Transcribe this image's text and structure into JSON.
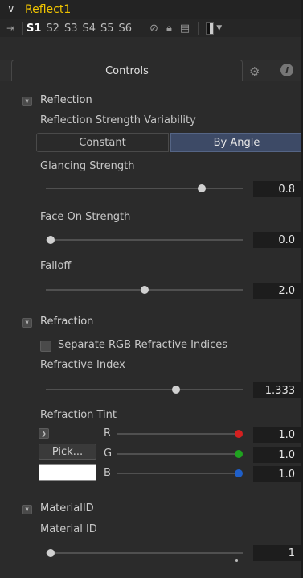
{
  "tool": {
    "title": "Reflect1",
    "slots": [
      "S1",
      "S2",
      "S3",
      "S4",
      "S5",
      "S6"
    ],
    "active_slot": "S1"
  },
  "tabs": {
    "controls": "Controls"
  },
  "reflection": {
    "section": "Reflection",
    "variability_label": "Reflection Strength Variability",
    "options": [
      "Constant",
      "By Angle"
    ],
    "selected": "By Angle",
    "glancing": {
      "label": "Glancing Strength",
      "value": "0.8",
      "fraction": 0.8
    },
    "face_on": {
      "label": "Face On Strength",
      "value": "0.0",
      "fraction": 0.0
    },
    "falloff": {
      "label": "Falloff",
      "value": "2.0",
      "fraction": 0.5
    }
  },
  "refraction": {
    "section": "Refraction",
    "separate_rgb_label": "Separate RGB Refractive Indices",
    "separate_rgb_checked": false,
    "index": {
      "label": "Refractive Index",
      "value": "1.333",
      "fraction": 0.67
    },
    "tint": {
      "label": "Refraction Tint",
      "pick_label": "Pick...",
      "swatch_color": "#ffffff",
      "channels": [
        {
          "name": "R",
          "value": "1.0",
          "color": "#d42020"
        },
        {
          "name": "G",
          "value": "1.0",
          "color": "#1fa31f"
        },
        {
          "name": "B",
          "value": "1.0",
          "color": "#1f5fc8"
        }
      ]
    }
  },
  "material": {
    "section": "MaterialID",
    "id_label": "Material ID",
    "value": "1",
    "fraction": 0.0
  },
  "colors": {
    "accent_title": "#f0c400",
    "selected_button": "#3d4a66"
  }
}
